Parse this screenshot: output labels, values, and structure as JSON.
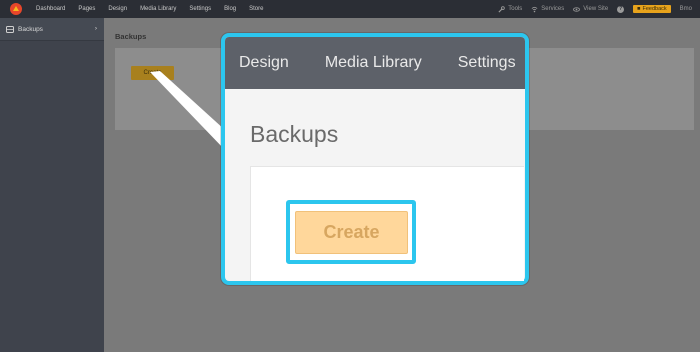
{
  "topbar": {
    "nav": [
      "Dashboard",
      "Pages",
      "Design",
      "Media Library",
      "Settings",
      "Blog",
      "Store"
    ],
    "tools": "Tools",
    "services": "Services",
    "view_site": "View Site",
    "feedback": "Feedback",
    "user": "Bmo"
  },
  "sidebar": {
    "items": [
      {
        "label": "Backups"
      }
    ]
  },
  "main": {
    "title": "Backups",
    "create_label": "Create"
  },
  "callout": {
    "nav": [
      "Design",
      "Media Library",
      "Settings"
    ],
    "title": "Backups",
    "create_label": "Create"
  },
  "colors": {
    "topbar": "#2b2e35",
    "sidebar": "#3f434c",
    "highlight": "#2cc6ee",
    "create_button": "#ffd79b",
    "feedback_button": "#e7a31c"
  }
}
